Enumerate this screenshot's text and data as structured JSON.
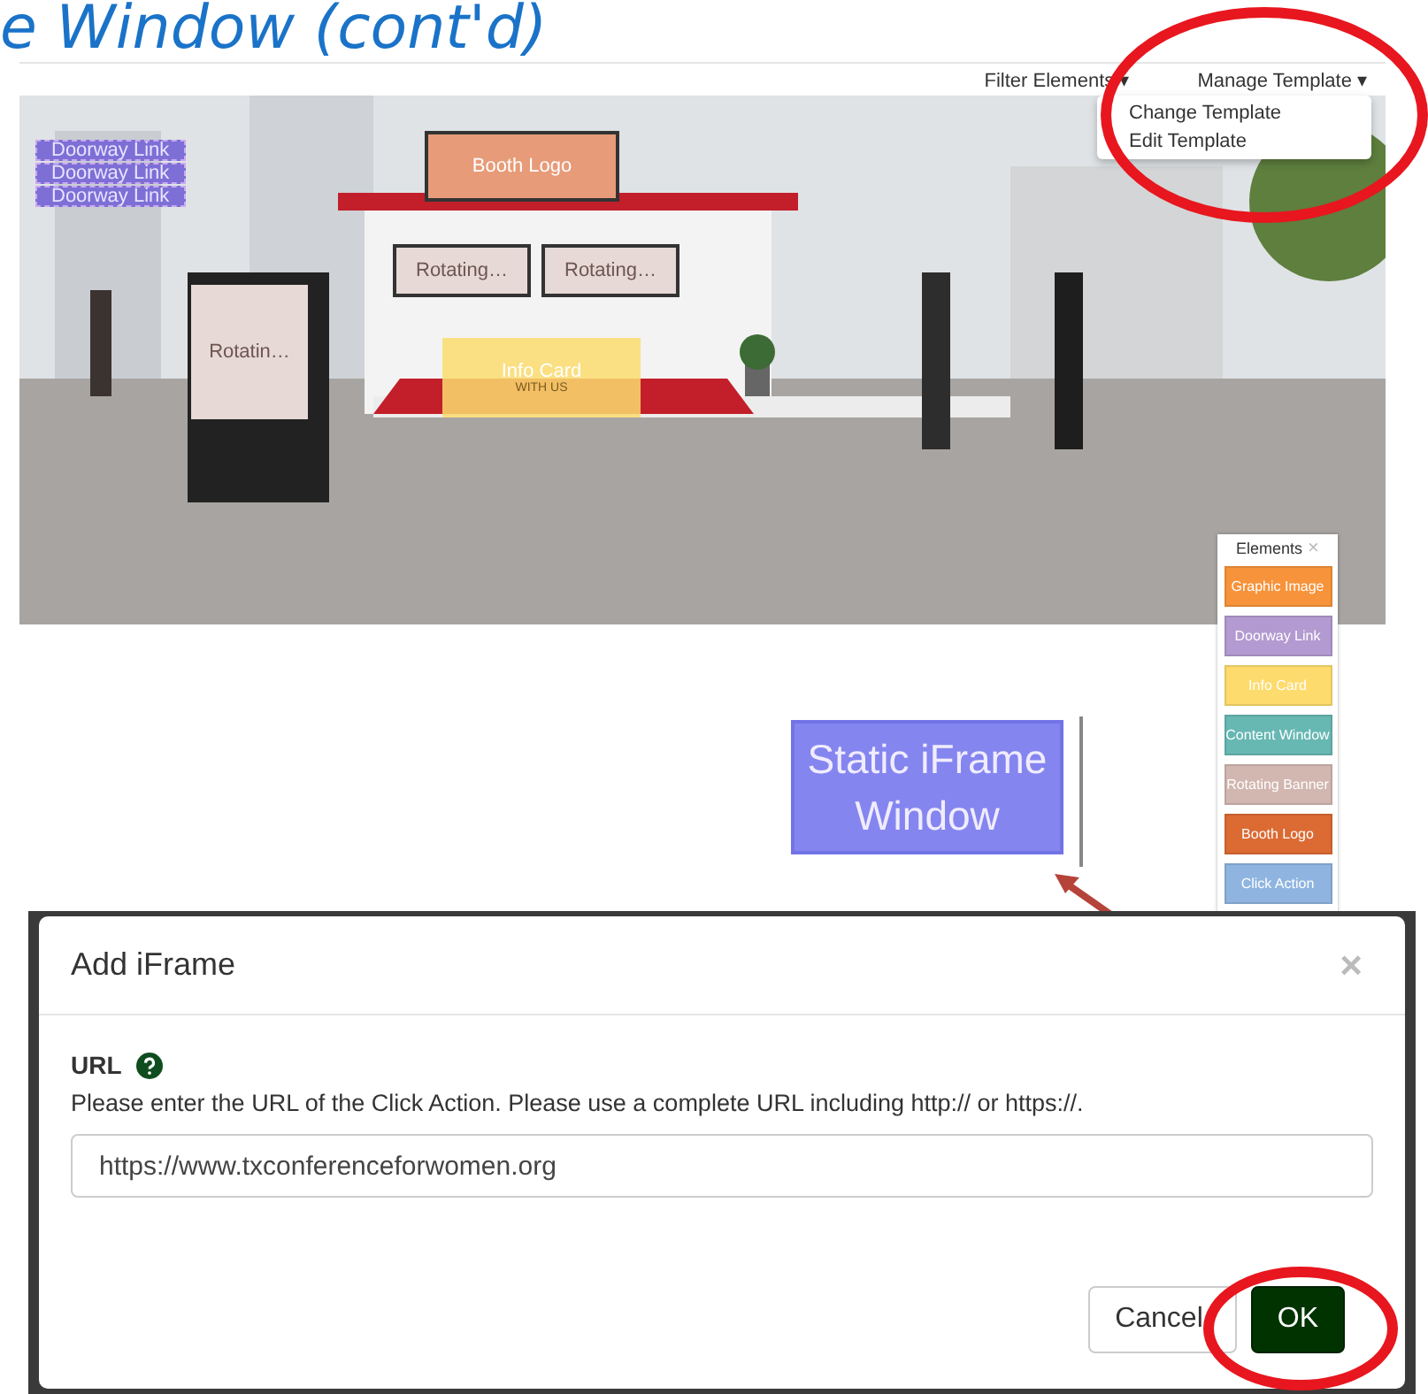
{
  "slide_title": "e Window (cont'd)",
  "editor": {
    "toolbar": {
      "filter_menu": "Filter Elements",
      "manage_menu": "Manage Template",
      "caret": "▾"
    },
    "dropdown": [
      "Change Template",
      "Edit Template"
    ],
    "scene": {
      "doorway_links": [
        "Doorway Link",
        "Doorway Link",
        "Doorway Link"
      ],
      "booth_logo": "Booth Logo",
      "banners": [
        "Rotating…",
        "Rotating…"
      ],
      "stand_banner": "Rotatin…",
      "info_card": {
        "title": "Info Card",
        "subtitle": "WITH US"
      }
    }
  },
  "elements_panel": {
    "title": "Elements",
    "close": "×",
    "items": [
      {
        "label": "Graphic Image",
        "color": "#f7933a"
      },
      {
        "label": "Doorway Link",
        "color": "#b39ad0"
      },
      {
        "label": "Info Card",
        "color": "#fddb6d"
      },
      {
        "label": "Content Window",
        "color": "#67b7b3"
      },
      {
        "label": "Rotating Banner",
        "color": "#d2b6b0"
      },
      {
        "label": "Booth Logo",
        "color": "#db6a33"
      },
      {
        "label": "Click Action",
        "color": "#8fb4e0"
      }
    ]
  },
  "static_iframe": "Static iFrame Window",
  "dialog": {
    "title": "Add iFrame",
    "close": "×",
    "field_label": "URL",
    "hint": "Please enter the URL of the Click Action. Please use a complete URL including http:// or https://.",
    "value": "https://www.txconferenceforwomen.org",
    "buttons": [
      {
        "label": "Cancel",
        "kind": "secondary"
      },
      {
        "label": "OK",
        "kind": "primary"
      }
    ]
  }
}
